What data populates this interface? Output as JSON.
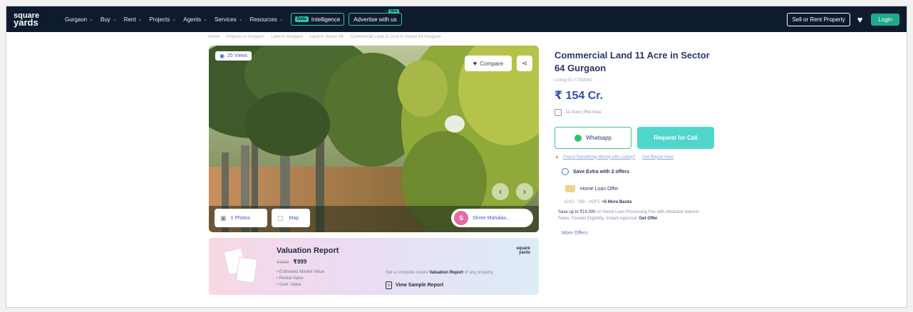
{
  "nav": {
    "logo_line1": "square",
    "logo_line2": "yards",
    "items": [
      {
        "label": "Gurgaon"
      },
      {
        "label": "Buy"
      },
      {
        "label": "Rent"
      },
      {
        "label": "Projects"
      },
      {
        "label": "Agents"
      },
      {
        "label": "Services"
      },
      {
        "label": "Resources"
      }
    ],
    "intel_badge": "Data",
    "intel_label": "Intelligence",
    "advertise_label": "Advertise with us",
    "advertise_badge": "New",
    "sell_label": "Sell or Rent Property",
    "login_label": "Login"
  },
  "breadcrumb": [
    "Home",
    "Projects in Gurgaon",
    "Land in Gurgaon",
    "Land in Sector 64",
    "Commercial Land 11 Acre in Sector 64 Gurgaon"
  ],
  "gallery": {
    "views": "25 Views",
    "compare_label": "Compare",
    "photos_label": "1 Photos",
    "map_label": "Map",
    "agent_initial": "S",
    "agent_name": "Shree Mahalax..."
  },
  "valuation": {
    "title": "Valuation Report",
    "old_price": "₹4999",
    "new_price": "₹999",
    "bullets": [
      "Estimated Market Value",
      "Rental Value",
      "Govt. Value"
    ],
    "brand_line1": "square",
    "brand_line2": "yards",
    "desc_prefix": "Get a complete review",
    "desc_bold": "Valuation Report",
    "desc_suffix": "of any property",
    "sample_label": "View Sample Report"
  },
  "listing": {
    "title": "Commercial Land 11 Acre in Sector 64 Gurgaon",
    "listing_id": "Listing ID #7383981",
    "price": "₹ 154 Cr.",
    "area": "11 Acre | Plot Area",
    "whatsapp_label": "Whatsapp",
    "call_label": "Request for Call",
    "warning_link": "Found Something Wrong with Listing?",
    "report_link": "Get Report Here",
    "offers_heading": "Save Extra with 2 offers",
    "loan_offer": "Home Loan Offer",
    "banks": "ICICI · SBI · HDFC",
    "banks_more": "+5 More Banks",
    "save_strong": "Save up to ₹15,000",
    "save_text": "on Home Loan Processing Fee with Attractive Interest Rates, Greater Eligibility, Instant Approval.",
    "get_offer": "Get Offer",
    "more_offers": "More Offers"
  }
}
